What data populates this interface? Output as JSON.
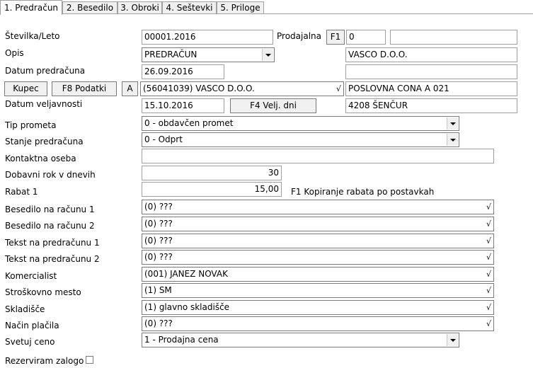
{
  "tabs": [
    "1. Predračun",
    "2. Besedilo",
    "3. Obroki",
    "4. Seštevki",
    "5. Priloge"
  ],
  "fields": {
    "stevilka_label": "Številka/Leto",
    "stevilka_value": "00001.2016",
    "prodajalna_label": "Prodajalna",
    "prodajalna_btn": "F1",
    "prodajalna_value": "0",
    "prodajalna_name": "",
    "opis_label": "Opis",
    "opis_value": "PREDRAČUN",
    "datum_label": "Datum predračuna",
    "datum_value": "26.09.2016",
    "kupec_btn": "Kupec",
    "f8_btn": "F8 Podatki",
    "a_btn": "A",
    "kupec_value": "(56041039) VASCO D.O.O.",
    "veljavnost_label": "Datum veljavnosti",
    "veljavnost_value": "15.10.2016",
    "f4_btn": "F4 Velj. dni",
    "addr1": "VASCO D.O.O.",
    "addr2": "",
    "addr3": "POSLOVNA CONA A 021",
    "addr4": "4208 ŠENČUR",
    "tip_label": "Tip prometa",
    "tip_value": "0 - obdavčen promet",
    "stanje_label": "Stanje predračuna",
    "stanje_value": "0 - Odprt",
    "kontakt_label": "Kontaktna oseba",
    "kontakt_value": "",
    "rok_label": "Dobavni rok v dnevih",
    "rok_value": "30",
    "rabat_label": "Rabat 1",
    "rabat_value": "15,00",
    "rabat_note": "F1 Kopiranje rabata po postavkah",
    "bes1_label": "Besedilo na računu 1",
    "bes1_value": "(0) ???",
    "bes2_label": "Besedilo na računu 2",
    "bes2_value": "(0) ???",
    "teks1_label": "Tekst na predračunu 1",
    "teks1_value": "(0) ???",
    "teks2_label": "Tekst na predračunu 2",
    "teks2_value": "(0) ???",
    "kom_label": "Komercialist",
    "kom_value": "(001) JANEZ NOVAK",
    "strm_label": "Stroškovno mesto",
    "strm_value": "(1) SM",
    "skl_label": "Skladišče",
    "skl_value": "(1) glavno skladišče",
    "nacin_label": "Način plačila",
    "nacin_value": "(0) ???",
    "svetuj_label": "Svetuj ceno",
    "svetuj_value": "1 - Prodajna cena",
    "rezerv_label": "Rezerviram zalogo"
  },
  "check_glyph": "√"
}
